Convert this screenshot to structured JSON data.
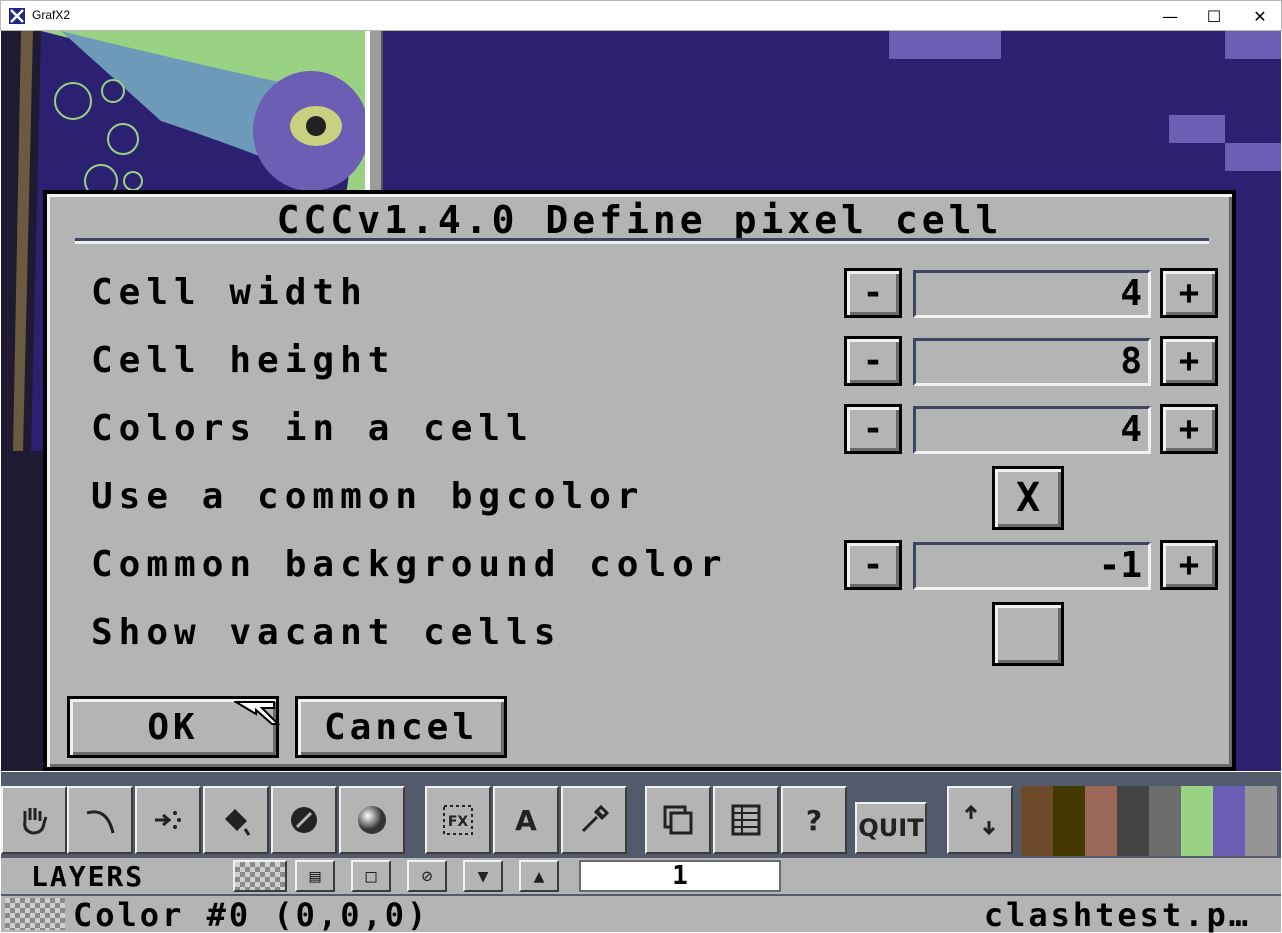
{
  "window": {
    "title": "GrafX2",
    "minimize": "—",
    "maximize": "☐",
    "close": "✕"
  },
  "dialog": {
    "title": "CCCv1.4.0 Define pixel cell",
    "rows": [
      {
        "label": "Cell width",
        "value": "4",
        "minus": "-",
        "plus": "+"
      },
      {
        "label": "Cell height",
        "value": "8",
        "minus": "-",
        "plus": "+"
      },
      {
        "label": "Colors in a cell",
        "value": "4",
        "minus": "-",
        "plus": "+"
      },
      {
        "label": "Use a common bgcolor",
        "checked_mark": "X"
      },
      {
        "label": "Common background color",
        "value": "-1",
        "minus": "-",
        "plus": "+"
      },
      {
        "label": "Show vacant cells",
        "checked_mark": ""
      }
    ],
    "ok_label": "OK",
    "cancel_label": "Cancel"
  },
  "toolbar": {
    "tools": [
      "hand-icon",
      "curve-icon",
      "spray-icon",
      "fill-icon",
      "gradient-icon",
      "sphere-icon",
      "effects-icon",
      "text-icon",
      "eyedropper-icon",
      "layers-copy-icon",
      "palette-grid-icon",
      "help-icon"
    ],
    "help_label": "?",
    "text_label": "A",
    "quit_label": "QUIT",
    "palette": [
      "#6d4b2a",
      "#433900",
      "#9a6759",
      "#444444",
      "#6c6c6c",
      "#9ad284",
      "#6c5eb5",
      "#959595"
    ]
  },
  "layers": {
    "label": "LAYERS",
    "current": "1"
  },
  "status": {
    "color_text": "Color #0 (0,0,0)",
    "file_text": "clashtest.p…"
  }
}
